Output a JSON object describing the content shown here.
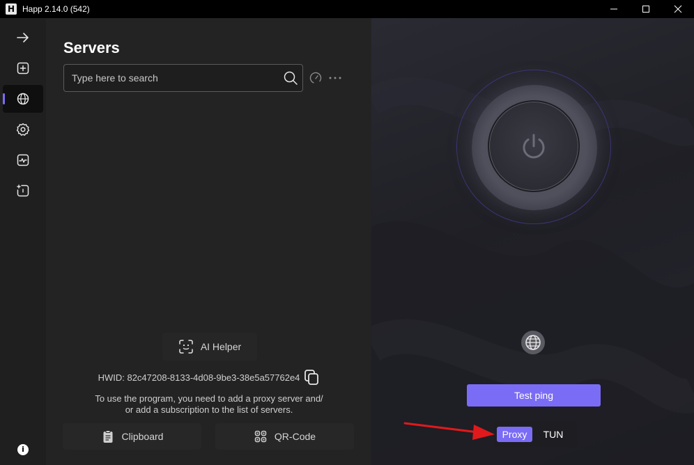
{
  "window": {
    "logo": "H",
    "title": "Happ 2.14.0 (542)"
  },
  "sidebar": {
    "items": [
      {
        "icon": "arrow-right-icon"
      },
      {
        "icon": "add-square-icon"
      },
      {
        "icon": "globe-icon",
        "active": true
      },
      {
        "icon": "gear-icon"
      },
      {
        "icon": "activity-monitor-icon"
      },
      {
        "icon": "split-tunnel-icon"
      }
    ],
    "info_label": "i"
  },
  "servers": {
    "title": "Servers",
    "search_placeholder": "Type here to search",
    "ai_helper_label": "AI Helper",
    "hwid_text": "HWID: 82c47208-8133-4d08-9be3-38e5a57762e4",
    "hint_line1": "To use the program, you need to add a proxy server and/",
    "hint_line2": "or add a subscription to the list of servers.",
    "clipboard_label": "Clipboard",
    "qrcode_label": "QR-Code"
  },
  "connection": {
    "test_ping_label": "Test ping",
    "modes": [
      "Proxy",
      "TUN"
    ],
    "selected_mode": "Proxy"
  },
  "colors": {
    "accent": "#7b6cf6",
    "annotation_arrow": "#e0191c"
  }
}
